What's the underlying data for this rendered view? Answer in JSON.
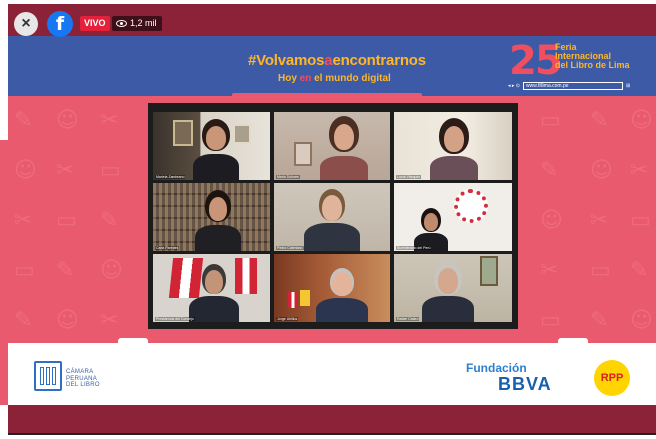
{
  "player": {
    "close_icon": "×",
    "facebook_icon": "f",
    "live_label": "VIVO",
    "viewers": "1,2 mil"
  },
  "banner": {
    "hashtag_pre": "#Volvamos",
    "hashtag_a": "a",
    "hashtag_post": "encontrarnos",
    "subtitle_pre": "Hoy ",
    "subtitle_en": "en",
    "subtitle_post": " el mundo digital",
    "fil_number": "25",
    "fil_line1": "Feria",
    "fil_line2": "Internacional",
    "fil_line3": "del Libro de Lima",
    "fil_url": "www.fillima.com.pe",
    "fil_url_prefix": "◂ ▸ ⊙",
    "fil_url_suffix": "⊞"
  },
  "participants": [
    {
      "name": "Mariela Zambrano"
    },
    {
      "name": "Maria Dolores"
    },
    {
      "name": "Lucía Vásquez"
    },
    {
      "name": "Carla Paredes"
    },
    {
      "name": "Pedro Cateriano"
    },
    {
      "name": "Bicentenario del Perú"
    },
    {
      "name": "Presidencia del Consejo"
    },
    {
      "name": "Jorge Ubillus"
    },
    {
      "name": "Rafael Castro"
    }
  ],
  "footer": {
    "camara_line1": "CÁMARA",
    "camara_line2": "PERUANA",
    "camara_line3": "DEL LIBRO",
    "fundacion": "Fundación",
    "bbva": "BBVA",
    "rpp": "RPP"
  },
  "colors": {
    "maroon": "#8c2238",
    "banner_blue": "#3d5aa6",
    "pink": "#ea5a6e",
    "gold": "#ffb627",
    "live_red": "#e3213a",
    "rpp_yellow": "#ffd400"
  }
}
